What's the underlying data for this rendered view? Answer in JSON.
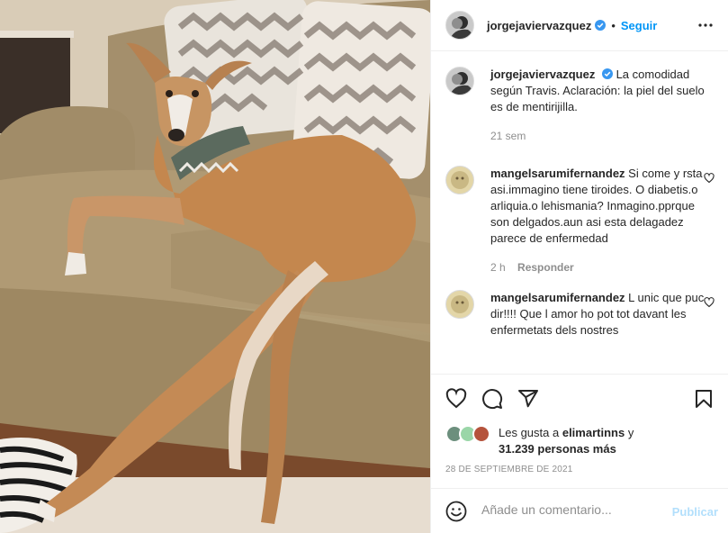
{
  "post": {
    "author": "jorgejaviervazquez",
    "follow_label": "Seguir",
    "separator": "•",
    "caption": "La comodidad según Travis. Aclaración: la piel del suelo es de mentirijilla.",
    "caption_age": "21 sem",
    "image_subject": "greyhound-on-sofa"
  },
  "comments": [
    {
      "user": "mangelsarumifernandez",
      "text": "Si come y rsta asi.immagino tiene tiroides. O diabetis.o arliquia.o lehismania? Inmagino.pprque son delgados.aun asi esta delagadez parece de enfermedad",
      "age": "2 h",
      "reply_label": "Responder"
    },
    {
      "user": "mangelsarumifernandez",
      "text": "L unic que puc dir!!!! Que l amor ho pot tot davant les enfermetats dels nostres",
      "age": "",
      "reply_label": ""
    }
  ],
  "likes": {
    "line1_prefix": "Les gusta a",
    "line1_user": "elimartinns",
    "line1_suffix": "y",
    "line2": "31.239 personas más"
  },
  "date": "28 DE SEPTIEMBRE DE 2021",
  "add_comment": {
    "placeholder": "Añade un comentario...",
    "publish_label": "Publicar"
  },
  "icons": [
    "heart-icon",
    "comment-icon",
    "share-icon",
    "bookmark-icon",
    "more-icon",
    "emoji-icon",
    "verified-icon"
  ],
  "colors": {
    "accent": "#0095f6",
    "publish_disabled": "#b2dffc",
    "muted": "#8e8e8e",
    "text": "#262626"
  }
}
